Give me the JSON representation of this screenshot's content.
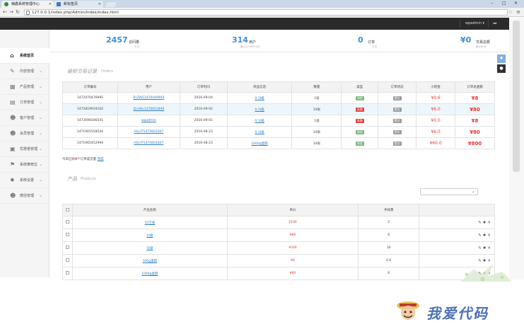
{
  "browser": {
    "tabs": [
      {
        "title": "嗨鑫系统管理中心",
        "active": true
      },
      {
        "title": "新标签页",
        "active": false
      }
    ],
    "url": "127.0.0.1/index.php/Admin/Index/index.html"
  },
  "header": {
    "user": "wpadmin"
  },
  "sidebar": {
    "items": [
      {
        "label": "系统首页",
        "icon": "home-icon",
        "glyph": "⌂",
        "active": true
      },
      {
        "label": "内容管理",
        "icon": "edit-icon",
        "glyph": "✎",
        "active": false
      },
      {
        "label": "产品管理",
        "icon": "calendar-icon",
        "glyph": "▦",
        "active": false
      },
      {
        "label": "订单管理",
        "icon": "grid-icon",
        "glyph": "▤",
        "active": false
      },
      {
        "label": "客户管理",
        "icon": "users-icon",
        "glyph": "☻",
        "active": false
      },
      {
        "label": "会员管理",
        "icon": "members-icon",
        "glyph": "☻",
        "active": false
      },
      {
        "label": "优惠卷管理",
        "icon": "image-icon",
        "glyph": "▣",
        "active": false
      },
      {
        "label": "系统推荐位",
        "icon": "flag-icon",
        "glyph": "⚑",
        "active": false
      },
      {
        "label": "系统设置",
        "icon": "gear-icon",
        "glyph": "✹",
        "active": false
      },
      {
        "label": "微信管理",
        "icon": "people-icon",
        "glyph": "☻",
        "active": false
      }
    ]
  },
  "stats": [
    {
      "value": "2457",
      "label": "访问量",
      "sub": "今日"
    },
    {
      "value": "314",
      "label": "用户",
      "sub": "截止2016年12月"
    },
    {
      "value": "0",
      "label": "订单",
      "sub": "今日"
    },
    {
      "value": "¥0",
      "label": "交易总额",
      "sub": "截止60天"
    }
  ],
  "orders": {
    "title": "最新交易记录",
    "subtitle": "Orders",
    "columns": [
      "订单编号",
      "用户",
      "订单时间",
      "商品信息",
      "数量",
      "类型",
      "订单状态",
      "小结金",
      "订单总金额"
    ],
    "rows": [
      {
        "id": "1472970476995",
        "user": "RrZWS1476449949",
        "date": "2016-09-04",
        "product": "0.1t级",
        "qty": "1张",
        "type": "浏览",
        "type_color": "#7fb77f",
        "status": "提交",
        "price": "¥0.6",
        "total": "¥8"
      },
      {
        "id": "1472819919102",
        "user": "QcHDs1476601849",
        "date": "2016-09-02",
        "product": "0.1t级",
        "qty": "10张",
        "type": "采购",
        "type_color": "#e43d3d",
        "status": "提交",
        "price": "¥6.0",
        "total": "¥80"
      },
      {
        "id": "1472699206541",
        "user": "wpadmin",
        "date": "2016-09-01",
        "product": "0.1t级",
        "qty": "1张",
        "type": "采购",
        "type_color": "#e43d3d",
        "status": "提交",
        "price": "¥0.0",
        "total": "¥8"
      },
      {
        "id": "1471965558544",
        "user": "HGcFf1474601847",
        "date": "2016-08-23",
        "product": "0.1t级",
        "qty": "10张",
        "type": "浏览",
        "type_color": "#7fb77f",
        "status": "提交",
        "price": "¥6.0",
        "total": "¥80"
      },
      {
        "id": "1471965452994",
        "user": "HGcFf1474601847",
        "date": "2016-08-23",
        "product": "1000g蛋糕",
        "qty": "10张",
        "type": "浏览",
        "type_color": "#7fb77f",
        "status": "提交",
        "price": "¥60.0",
        "total": "¥800"
      }
    ],
    "note_prefix": "今日已有",
    "note_count": "0",
    "note_middle": "个订单成交量",
    "note_link": "完成"
  },
  "products": {
    "title": "产品",
    "subtitle": "Products",
    "columns": [
      "产品名称",
      "单价",
      "手续费"
    ],
    "rows": [
      {
        "name": "10万张",
        "price": "¥100",
        "fee": "2"
      },
      {
        "name": "1t级",
        "price": "¥80",
        "fee": "6"
      },
      {
        "name": "5t级",
        "price": "¥200",
        "fee": "30"
      },
      {
        "name": "100g蛋糕",
        "price": "¥8",
        "fee": "0.6"
      },
      {
        "name": "1000g蛋糕",
        "price": "¥80",
        "fee": "6"
      }
    ]
  },
  "watermark": {
    "text": "我爱代码"
  }
}
